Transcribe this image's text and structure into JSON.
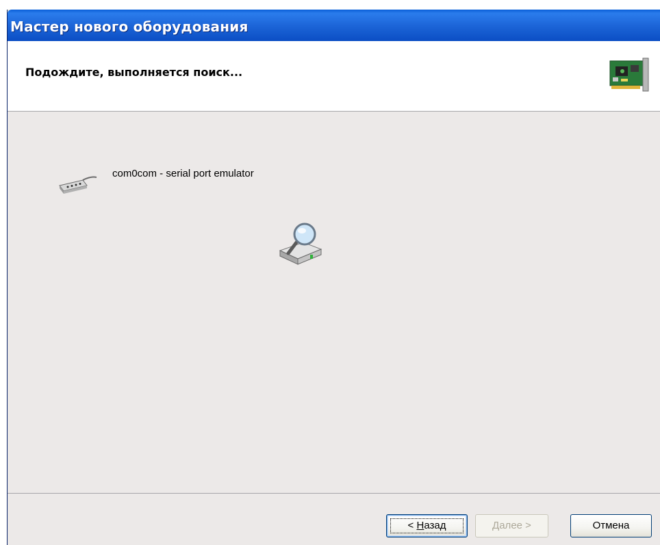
{
  "window": {
    "title": "Мастер нового оборудования"
  },
  "header": {
    "title": "Подождите, выполняется поиск...",
    "icon": "hardware-card-icon"
  },
  "main": {
    "device_label": "com0com - serial port emulator",
    "device_icon": "serial-port-icon",
    "search_icon": "searching-drive-icon"
  },
  "buttons": {
    "back": {
      "prefix": "< ",
      "accel": "Н",
      "rest": "азад"
    },
    "next": {
      "accel": "Д",
      "rest": "алее",
      "suffix": " >"
    },
    "cancel": "Отмена"
  },
  "colors": {
    "titlebar": "#0b5ed7",
    "panel": "#ece9e8",
    "focus_border": "#003c74"
  }
}
